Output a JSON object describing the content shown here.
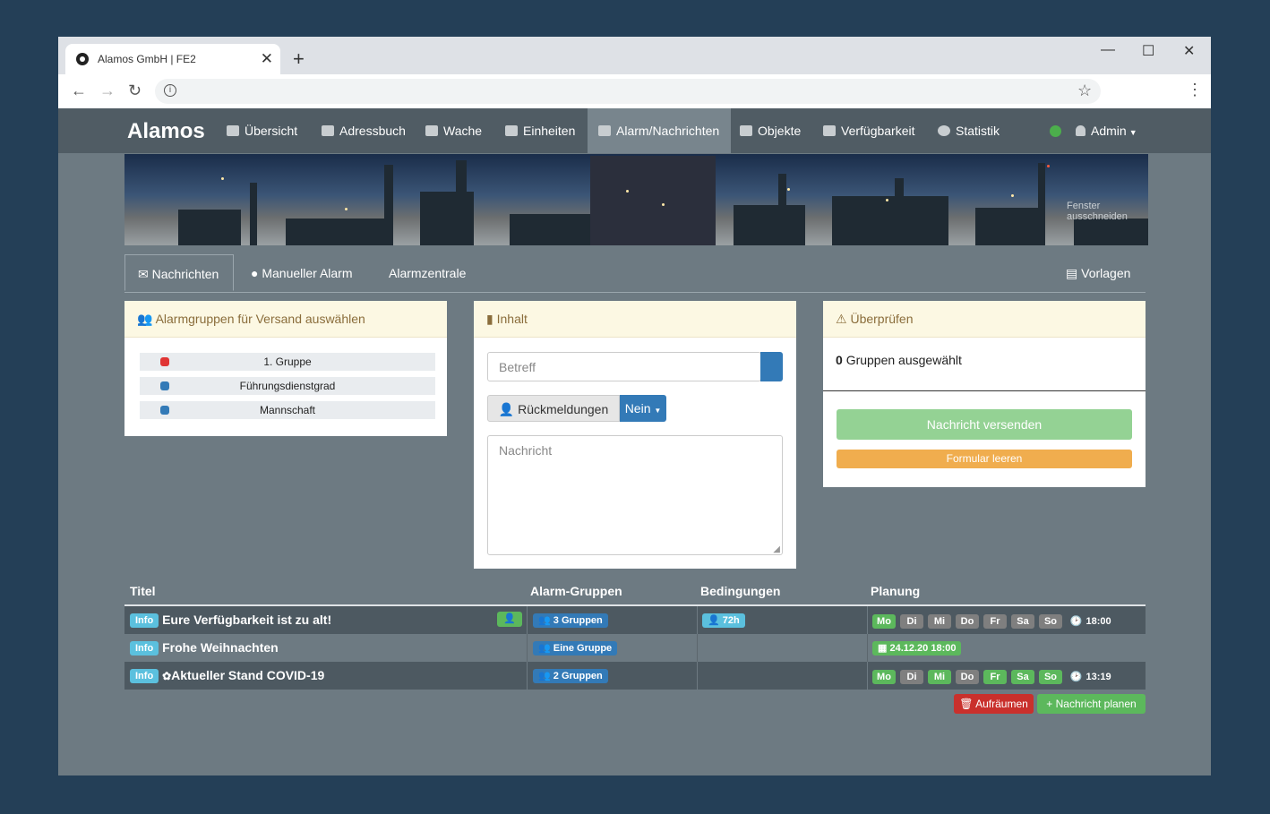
{
  "browser": {
    "tab_title": "Alamos GmbH | FE2",
    "tab_close": "✕",
    "new_tab": "+",
    "minimize": "—",
    "maximize": "☐",
    "close": "✕",
    "back": "←",
    "forward": "→",
    "reload": "↻",
    "info": "i",
    "star": "☆",
    "menu": "⋮"
  },
  "navbar": {
    "logo": "Alamos",
    "items": [
      {
        "label": "Übersicht",
        "icon": "alarm-light-icon"
      },
      {
        "label": "Adressbuch",
        "icon": "address-book-icon"
      },
      {
        "label": "Wache",
        "icon": "garage-icon"
      },
      {
        "label": "Einheiten",
        "icon": "list-icon"
      },
      {
        "label": "Alarm/Nachrichten",
        "icon": "bell-icon",
        "active": true
      },
      {
        "label": "Objekte",
        "icon": "building-icon"
      },
      {
        "label": "Verfügbarkeit",
        "icon": "users-icon"
      },
      {
        "label": "Statistik",
        "icon": "pie-chart-icon"
      }
    ],
    "status_color": "#4cae4c",
    "user": "Admin"
  },
  "banner": {
    "overlay_text": "Fenster ausschneiden"
  },
  "subtabs": {
    "items": [
      "Nachrichten",
      "Manueller Alarm",
      "Alarmzentrale"
    ],
    "right": "Vorlagen"
  },
  "groups_panel": {
    "title": "Alarmgruppen für Versand auswählen",
    "groups": [
      {
        "name": "1. Gruppe",
        "color": "#e03535"
      },
      {
        "name": "Führungsdienstgrad",
        "color": "#337ab7"
      },
      {
        "name": "Mannschaft",
        "color": "#337ab7"
      }
    ]
  },
  "content_panel": {
    "title": "Inhalt",
    "subject_placeholder": "Betreff",
    "feedback_label": "Rückmeldungen",
    "feedback_value": "Nein",
    "message_placeholder": "Nachricht"
  },
  "review_panel": {
    "title": "Überprüfen",
    "count": "0",
    "count_text": "Gruppen ausgewählt",
    "send_label": "Nachricht versenden",
    "clear_label": "Formular leeren"
  },
  "table": {
    "headers": [
      "Titel",
      "Alarm-Gruppen",
      "Bedingungen",
      "Planung"
    ],
    "rows": [
      {
        "tag": "Info",
        "title": "Eure Verfügbarkeit ist zu alt!",
        "groups": "3 Gruppen",
        "condition": "72h",
        "days": [
          true,
          false,
          false,
          false,
          false,
          false,
          false
        ],
        "time": "18:00"
      },
      {
        "tag": "Info",
        "title": "Frohe Weihnachten",
        "groups": "Eine Gruppe",
        "condition": "",
        "date": "24.12.20 18:00"
      },
      {
        "tag": "Info",
        "title": "Aktueller Stand COVID-19",
        "groups": "2 Gruppen",
        "condition": "",
        "days": [
          true,
          false,
          true,
          false,
          true,
          true,
          true
        ],
        "time": "13:19"
      }
    ],
    "day_labels": [
      "Mo",
      "Di",
      "Mi",
      "Do",
      "Fr",
      "Sa",
      "So"
    ],
    "cleanup_label": "Aufräumen",
    "plan_label": "Nachricht planen"
  }
}
